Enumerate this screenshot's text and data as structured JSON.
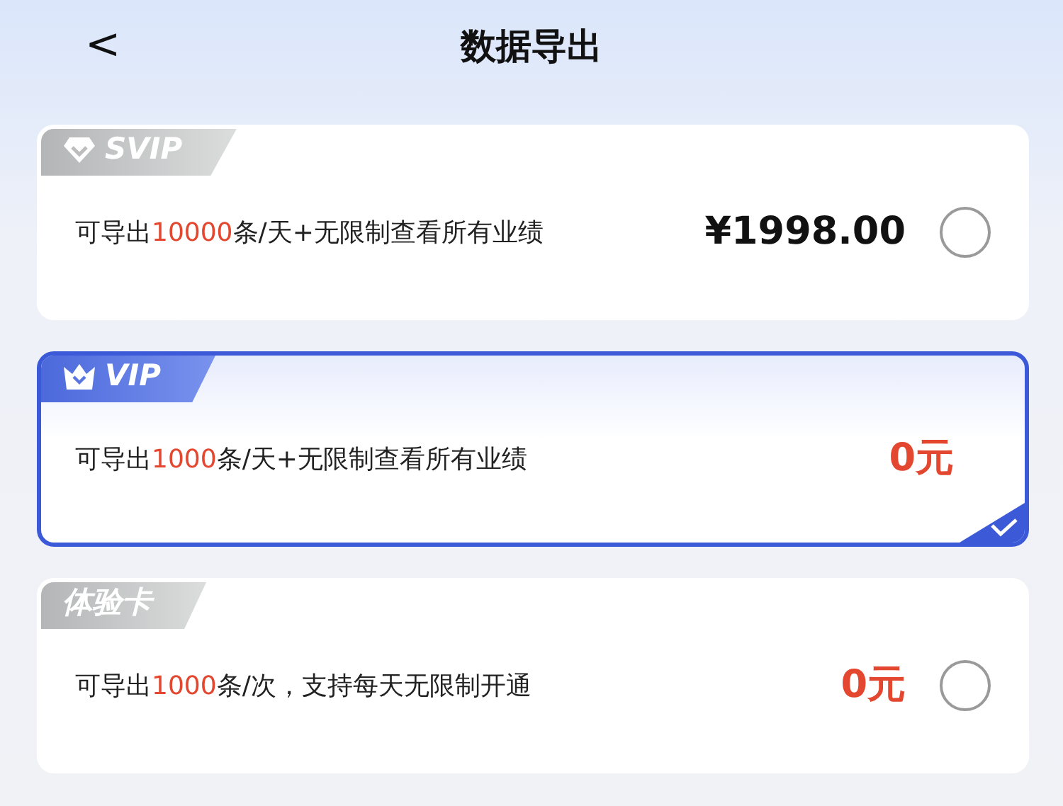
{
  "header": {
    "back": "<",
    "title": "数据导出"
  },
  "plans": [
    {
      "badge": "SVIP",
      "kind": "diamond",
      "desc_before": "可导出",
      "desc_highlight": "10000",
      "desc_after": "条/天+无限制查看所有业绩",
      "price": "¥1998.00",
      "color": "#111111",
      "selected": false
    },
    {
      "badge": "VIP",
      "kind": "crown",
      "desc_before": "可导出",
      "desc_highlight": "1000",
      "desc_after": "条/天+无限制查看所有业绩",
      "price": "0元",
      "color": "#e4472f",
      "selected": true
    },
    {
      "badge": "体验卡",
      "kind": "plain",
      "desc_before": "可导出",
      "desc_highlight": "1000",
      "desc_after": "条/次，支持每天无限制开通",
      "price": "0元",
      "color": "#e4472f",
      "selected": false
    }
  ]
}
